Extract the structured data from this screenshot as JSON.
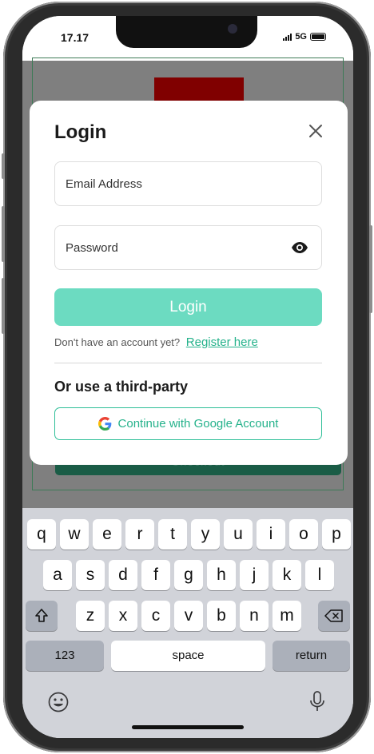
{
  "status_bar": {
    "time": "17.17",
    "network": "5G"
  },
  "background_app": {
    "button_label": "Checkout"
  },
  "login_modal": {
    "title": "Login",
    "email_placeholder": "Email Address",
    "password_placeholder": "Password",
    "login_button": "Login",
    "register_prompt": "Don't have an account yet?",
    "register_link": "Register here",
    "third_party_heading": "Or use a third-party",
    "google_button": "Continue with Google Account"
  },
  "keyboard": {
    "row1": [
      "q",
      "w",
      "e",
      "r",
      "t",
      "y",
      "u",
      "i",
      "o",
      "p"
    ],
    "row2": [
      "a",
      "s",
      "d",
      "f",
      "g",
      "h",
      "j",
      "k",
      "l"
    ],
    "row3": [
      "z",
      "x",
      "c",
      "v",
      "b",
      "n",
      "m"
    ],
    "numbers_key": "123",
    "space_key": "space",
    "return_key": "return"
  },
  "colors": {
    "accent": "#6cdbc1",
    "link": "#25b28b",
    "overlay": "#7f7f7f",
    "keyboard_bg": "#d1d3d9"
  },
  "icons": [
    "close-icon",
    "eye-icon",
    "google-logo-icon",
    "shift-icon",
    "backspace-icon",
    "emoji-icon",
    "microphone-icon"
  ]
}
